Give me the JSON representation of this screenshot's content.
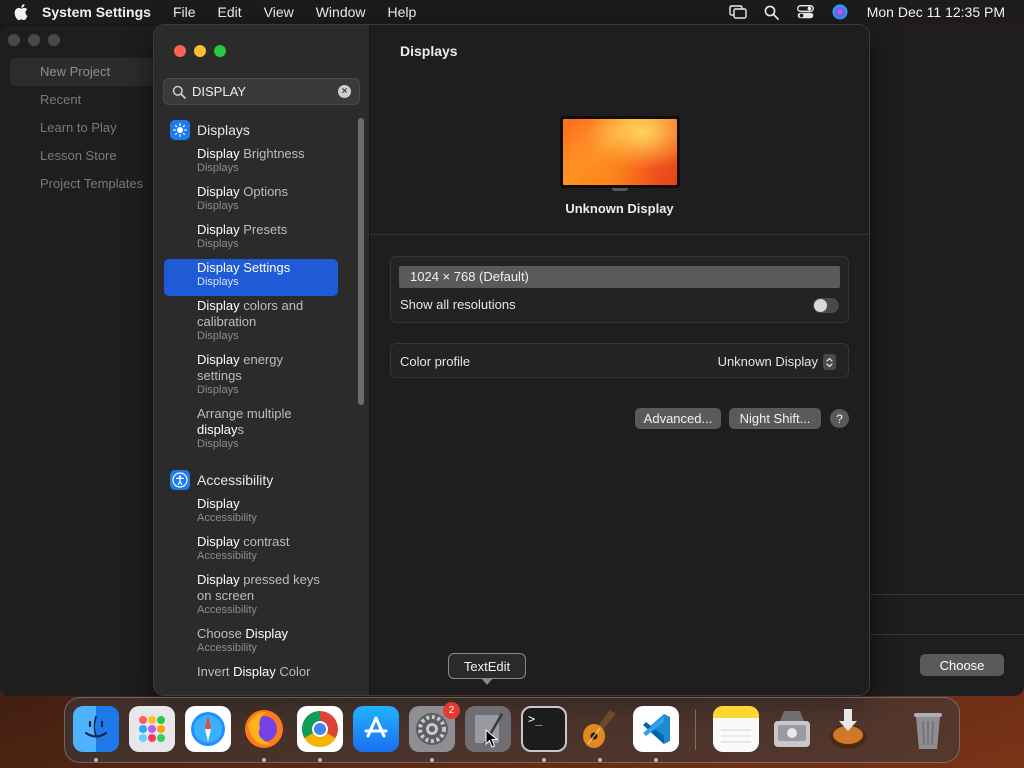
{
  "menubar": {
    "app_name": "System Settings",
    "menus": [
      "File",
      "Edit",
      "View",
      "Window",
      "Help"
    ],
    "clock": "Mon Dec 11  12:35 PM"
  },
  "background_app": {
    "sidebar_items": [
      "New Project",
      "Recent",
      "Learn to Play",
      "Lesson Store",
      "Project Templates"
    ],
    "choose_label": "Choose"
  },
  "settings": {
    "search": {
      "value": "DISPLAY"
    },
    "groups": [
      {
        "label": "Displays",
        "icon": "sun-icon",
        "color": "#1e7cf2",
        "results": [
          {
            "title": "Display Brightness",
            "sub": "Displays"
          },
          {
            "title": "Display Options",
            "sub": "Displays"
          },
          {
            "title": "Display Presets",
            "sub": "Displays"
          },
          {
            "title": "Display Settings",
            "sub": "Displays"
          },
          {
            "title": "Display colors and calibration",
            "sub": "Displays"
          },
          {
            "title": "Display energy settings",
            "sub": "Displays"
          },
          {
            "title": "Arrange multiple displays",
            "sub": "Displays"
          }
        ]
      },
      {
        "label": "Accessibility",
        "icon": "accessibility-icon",
        "color": "#1e7cf2",
        "results": [
          {
            "title": "Display",
            "sub": "Accessibility"
          },
          {
            "title": "Display contrast",
            "sub": "Accessibility"
          },
          {
            "title": "Display pressed keys on screen",
            "sub": "Accessibility"
          },
          {
            "title": "Choose Display",
            "sub": "Accessibility"
          },
          {
            "title": "Invert Display Color",
            "sub": ""
          }
        ]
      }
    ],
    "content": {
      "title": "Displays",
      "display_name": "Unknown Display",
      "resolution": "1024 × 768 (Default)",
      "show_all_label": "Show all resolutions",
      "color_profile_label": "Color profile",
      "color_profile_value": "Unknown Display",
      "advanced_label": "Advanced...",
      "night_shift_label": "Night Shift...",
      "help_label": "?"
    }
  },
  "tooltip": "TextEdit",
  "dock": {
    "items": [
      {
        "name": "finder",
        "icon": "finder-icon"
      },
      {
        "name": "launchpad",
        "icon": "launchpad-icon"
      },
      {
        "name": "safari",
        "icon": "safari-icon"
      },
      {
        "name": "firefox",
        "icon": "firefox-icon"
      },
      {
        "name": "chrome",
        "icon": "chrome-icon"
      },
      {
        "name": "app-store",
        "icon": "app-store-icon"
      },
      {
        "name": "system-settings",
        "icon": "gear-icon",
        "badge": "2"
      },
      {
        "name": "textedit",
        "icon": "textedit-icon"
      },
      {
        "name": "terminal",
        "icon": "terminal-icon",
        "label": ">_"
      },
      {
        "name": "garageband",
        "icon": "guitar-icon"
      },
      {
        "name": "vscode",
        "icon": "vscode-icon"
      },
      {
        "name": "notes",
        "icon": "notes-icon"
      },
      {
        "name": "disk-utility",
        "icon": "disk-utility-icon"
      },
      {
        "name": "installer",
        "icon": "installer-icon"
      },
      {
        "name": "trash",
        "icon": "trash-icon"
      }
    ]
  }
}
